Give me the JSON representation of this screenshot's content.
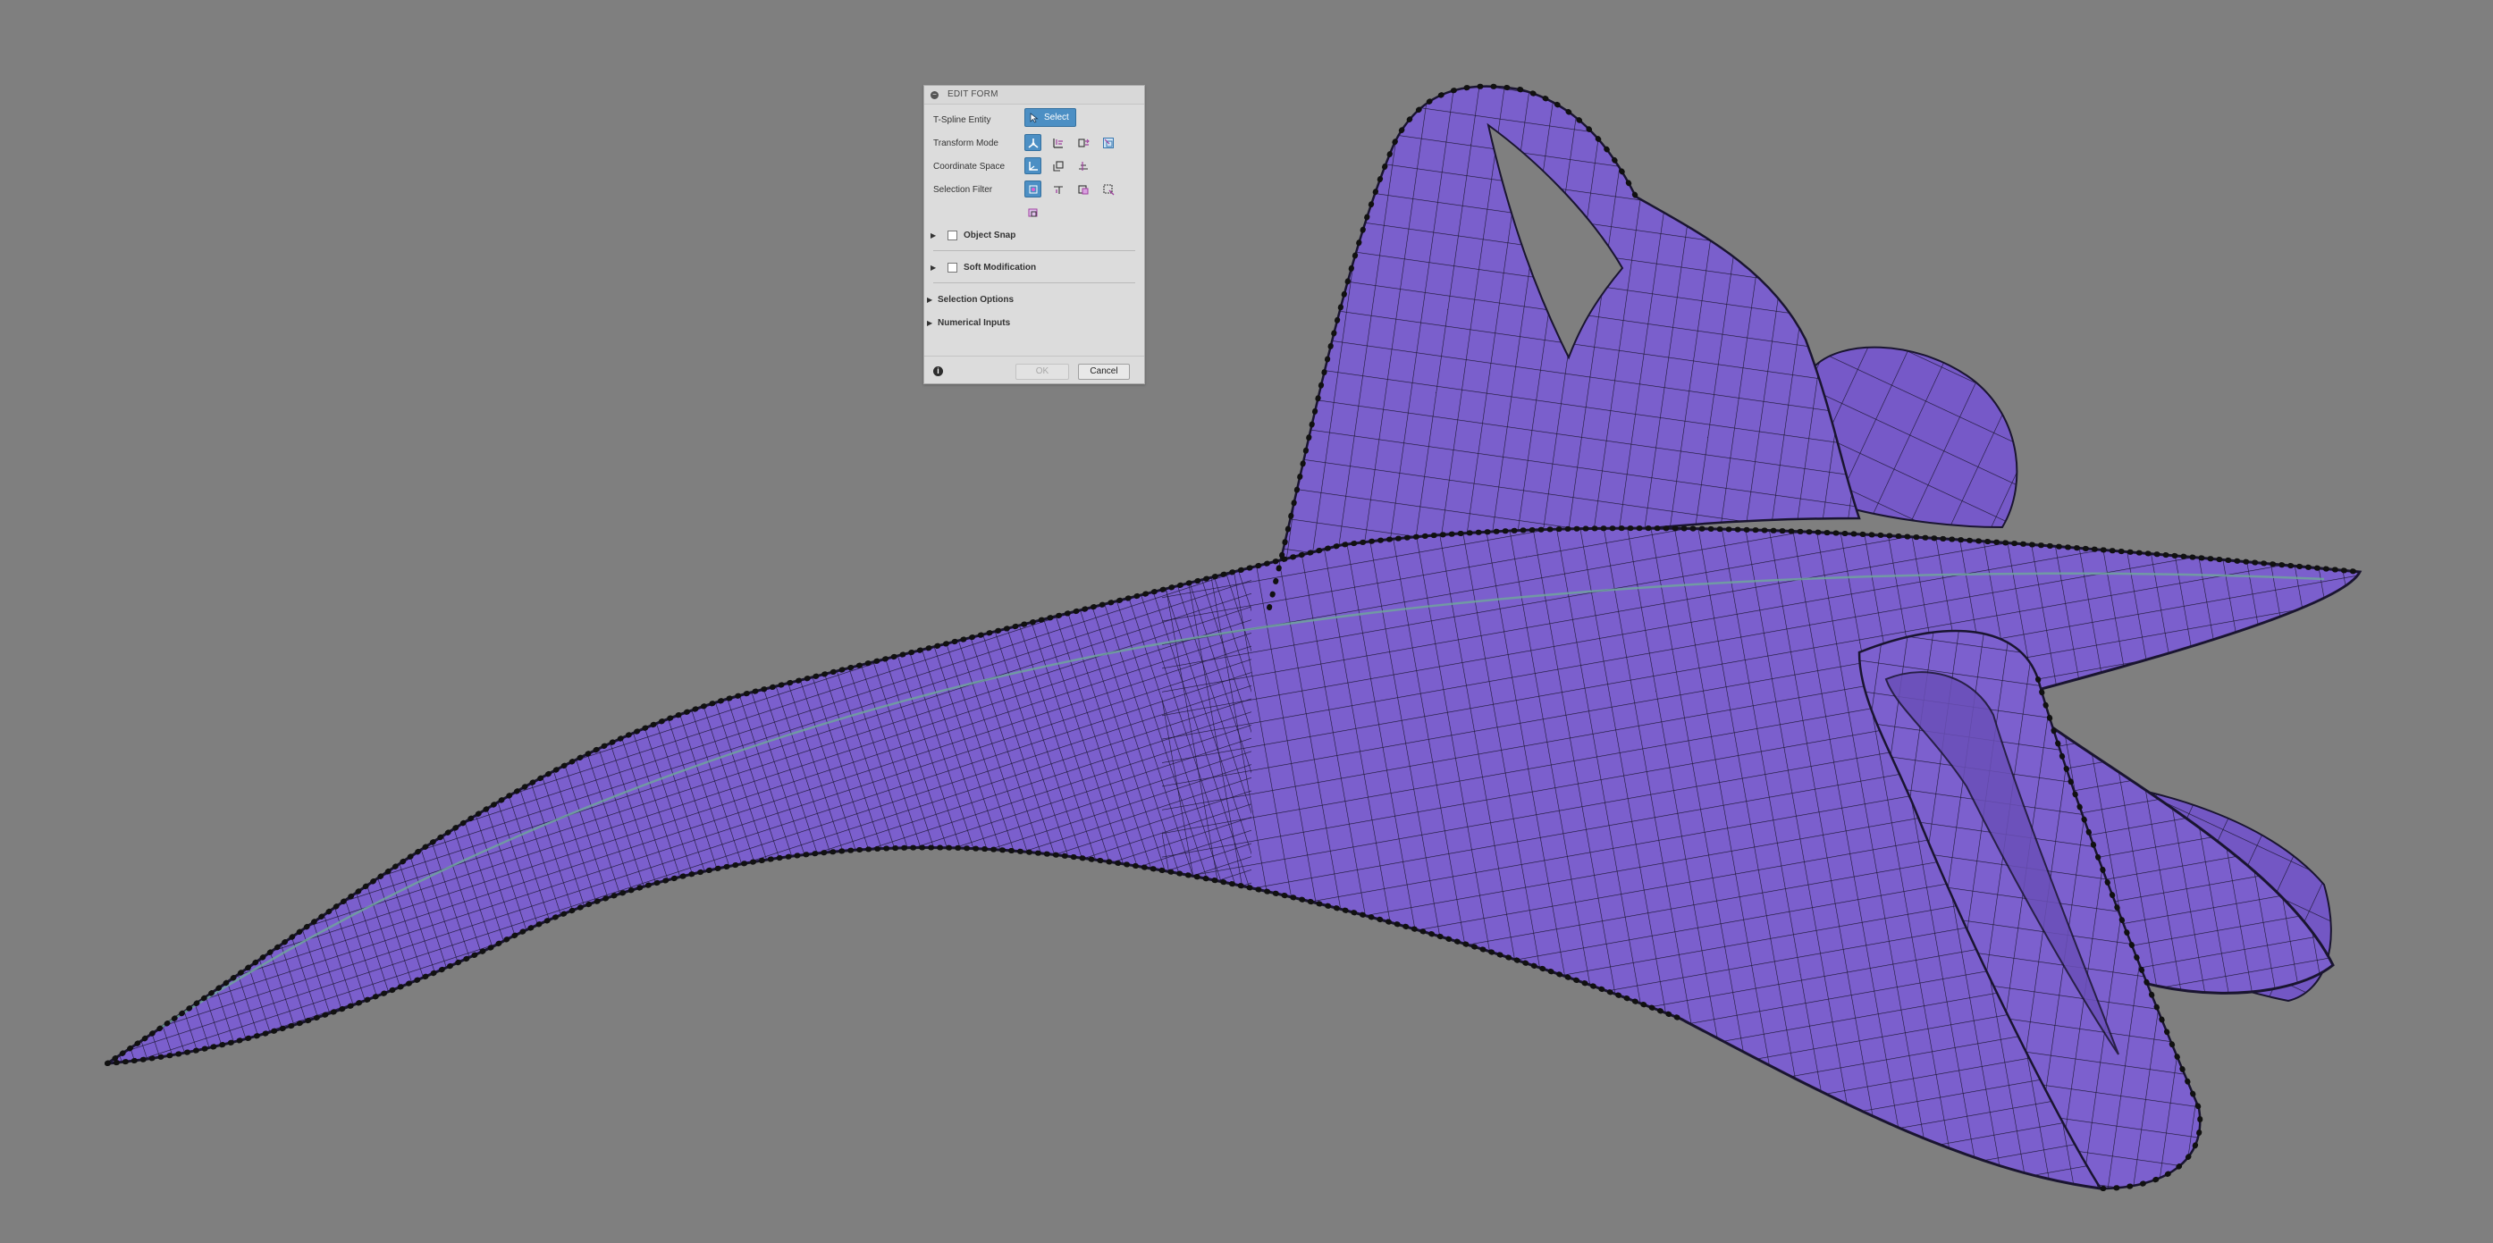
{
  "dialog": {
    "title": "EDIT FORM",
    "rows": {
      "tspline_entity": "T-Spline Entity",
      "transform_mode": "Transform Mode",
      "coordinate_space": "Coordinate Space",
      "selection_filter": "Selection Filter"
    },
    "select_label": "Select",
    "sections": {
      "object_snap": "Object Snap",
      "soft_modification": "Soft Modification",
      "selection_options": "Selection Options",
      "numerical_inputs": "Numerical Inputs"
    },
    "buttons": {
      "ok": "OK",
      "cancel": "Cancel"
    }
  },
  "icons": {
    "collapse": "minus-circle-icon",
    "select": "cursor-arrow-icon",
    "transform_mode": [
      "multi-axis-move-icon",
      "translate-icon",
      "rotate-icon",
      "scale-icon"
    ],
    "coordinate_space": [
      "world-space-icon",
      "view-space-icon",
      "local-space-icon"
    ],
    "selection_filter": [
      "vertex-filter-icon",
      "edge-filter-icon",
      "face-filter-icon",
      "body-filter-icon",
      "object-filter-icon"
    ],
    "info": "info-icon"
  },
  "colors": {
    "viewport_background": "#7f7f7f",
    "model_surface": "#7a5fcc",
    "mesh_lines": "#1a1530",
    "accent_active": "#4c8fc4"
  }
}
